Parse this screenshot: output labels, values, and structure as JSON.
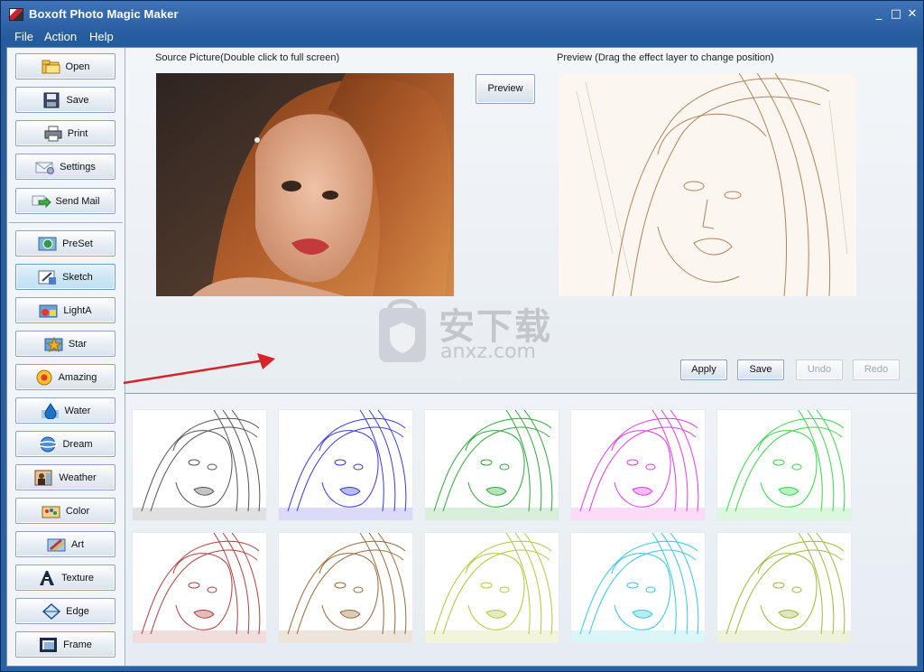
{
  "window": {
    "title": "Boxoft Photo Magic Maker",
    "controls": [
      "_",
      "□",
      "✕"
    ]
  },
  "menu": [
    "File",
    "Action",
    "Help"
  ],
  "sidebar": {
    "file_buttons": [
      {
        "label": "Open",
        "icon": "folder-icon"
      },
      {
        "label": "Save",
        "icon": "floppy-disk-icon"
      },
      {
        "label": "Print",
        "icon": "printer-icon"
      },
      {
        "label": "Settings",
        "icon": "settings-envelope-icon"
      },
      {
        "label": "Send Mail",
        "icon": "send-mail-arrow-icon"
      }
    ],
    "effect_buttons": [
      {
        "label": "PreSet",
        "icon": "preset-icon"
      },
      {
        "label": "Sketch",
        "icon": "sketch-icon",
        "active": true
      },
      {
        "label": "LightA",
        "icon": "light-icon"
      },
      {
        "label": "Star",
        "icon": "star-icon"
      },
      {
        "label": "Amazing",
        "icon": "amazing-icon"
      },
      {
        "label": "Water",
        "icon": "water-drop-icon"
      },
      {
        "label": "Dream",
        "icon": "dream-globe-icon"
      },
      {
        "label": "Weather",
        "icon": "weather-icon"
      },
      {
        "label": "Color",
        "icon": "color-palette-icon"
      },
      {
        "label": "Art",
        "icon": "art-brush-icon"
      },
      {
        "label": "Texture",
        "icon": "texture-letter-icon"
      },
      {
        "label": "Edge",
        "icon": "edge-diamond-icon"
      },
      {
        "label": "Frame",
        "icon": "frame-icon"
      }
    ]
  },
  "main": {
    "source_label": "Source Picture(Double click to full screen)",
    "preview_label": "Preview (Drag the effect layer to change position)",
    "preview_button": "Preview",
    "actions": {
      "apply": "Apply",
      "save": "Save",
      "undo": "Undo",
      "redo": "Redo"
    },
    "thumb_tints": [
      "#555555",
      "#3a3ae0",
      "#2fa83a",
      "#e23ce0",
      "#36d84a",
      "#b04040",
      "#9a6a3a",
      "#b8c63a",
      "#35c8e0",
      "#a0b83a"
    ]
  },
  "watermark": {
    "cn_text": "安下载",
    "url_text": "anxz.com"
  }
}
